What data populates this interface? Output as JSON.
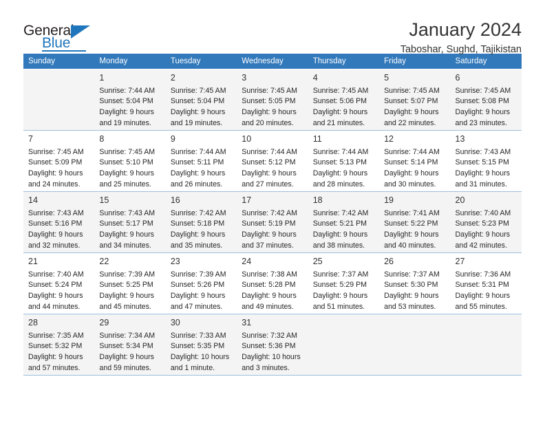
{
  "brand": {
    "word_one": "General",
    "word_two": "Blue",
    "logo_icon": "triangle-flag-icon"
  },
  "header": {
    "month_title": "January 2024",
    "location": "Taboshar, Sughd, Tajikistan"
  },
  "theme": {
    "header_blue": "#3279bb",
    "brand_blue": "#1f76bc",
    "row_alt_bg": "#f4f4f4",
    "grid_line": "#9bbfdd",
    "text": "#262626"
  },
  "calendar": {
    "columns": [
      "Sunday",
      "Monday",
      "Tuesday",
      "Wednesday",
      "Thursday",
      "Friday",
      "Saturday"
    ],
    "weeks": [
      [
        {
          "day": "",
          "info": ""
        },
        {
          "day": "1",
          "info": "Sunrise: 7:44 AM\nSunset: 5:04 PM\nDaylight: 9 hours\nand 19 minutes."
        },
        {
          "day": "2",
          "info": "Sunrise: 7:45 AM\nSunset: 5:04 PM\nDaylight: 9 hours\nand 19 minutes."
        },
        {
          "day": "3",
          "info": "Sunrise: 7:45 AM\nSunset: 5:05 PM\nDaylight: 9 hours\nand 20 minutes."
        },
        {
          "day": "4",
          "info": "Sunrise: 7:45 AM\nSunset: 5:06 PM\nDaylight: 9 hours\nand 21 minutes."
        },
        {
          "day": "5",
          "info": "Sunrise: 7:45 AM\nSunset: 5:07 PM\nDaylight: 9 hours\nand 22 minutes."
        },
        {
          "day": "6",
          "info": "Sunrise: 7:45 AM\nSunset: 5:08 PM\nDaylight: 9 hours\nand 23 minutes."
        }
      ],
      [
        {
          "day": "7",
          "info": "Sunrise: 7:45 AM\nSunset: 5:09 PM\nDaylight: 9 hours\nand 24 minutes."
        },
        {
          "day": "8",
          "info": "Sunrise: 7:45 AM\nSunset: 5:10 PM\nDaylight: 9 hours\nand 25 minutes."
        },
        {
          "day": "9",
          "info": "Sunrise: 7:44 AM\nSunset: 5:11 PM\nDaylight: 9 hours\nand 26 minutes."
        },
        {
          "day": "10",
          "info": "Sunrise: 7:44 AM\nSunset: 5:12 PM\nDaylight: 9 hours\nand 27 minutes."
        },
        {
          "day": "11",
          "info": "Sunrise: 7:44 AM\nSunset: 5:13 PM\nDaylight: 9 hours\nand 28 minutes."
        },
        {
          "day": "12",
          "info": "Sunrise: 7:44 AM\nSunset: 5:14 PM\nDaylight: 9 hours\nand 30 minutes."
        },
        {
          "day": "13",
          "info": "Sunrise: 7:43 AM\nSunset: 5:15 PM\nDaylight: 9 hours\nand 31 minutes."
        }
      ],
      [
        {
          "day": "14",
          "info": "Sunrise: 7:43 AM\nSunset: 5:16 PM\nDaylight: 9 hours\nand 32 minutes."
        },
        {
          "day": "15",
          "info": "Sunrise: 7:43 AM\nSunset: 5:17 PM\nDaylight: 9 hours\nand 34 minutes."
        },
        {
          "day": "16",
          "info": "Sunrise: 7:42 AM\nSunset: 5:18 PM\nDaylight: 9 hours\nand 35 minutes."
        },
        {
          "day": "17",
          "info": "Sunrise: 7:42 AM\nSunset: 5:19 PM\nDaylight: 9 hours\nand 37 minutes."
        },
        {
          "day": "18",
          "info": "Sunrise: 7:42 AM\nSunset: 5:21 PM\nDaylight: 9 hours\nand 38 minutes."
        },
        {
          "day": "19",
          "info": "Sunrise: 7:41 AM\nSunset: 5:22 PM\nDaylight: 9 hours\nand 40 minutes."
        },
        {
          "day": "20",
          "info": "Sunrise: 7:40 AM\nSunset: 5:23 PM\nDaylight: 9 hours\nand 42 minutes."
        }
      ],
      [
        {
          "day": "21",
          "info": "Sunrise: 7:40 AM\nSunset: 5:24 PM\nDaylight: 9 hours\nand 44 minutes."
        },
        {
          "day": "22",
          "info": "Sunrise: 7:39 AM\nSunset: 5:25 PM\nDaylight: 9 hours\nand 45 minutes."
        },
        {
          "day": "23",
          "info": "Sunrise: 7:39 AM\nSunset: 5:26 PM\nDaylight: 9 hours\nand 47 minutes."
        },
        {
          "day": "24",
          "info": "Sunrise: 7:38 AM\nSunset: 5:28 PM\nDaylight: 9 hours\nand 49 minutes."
        },
        {
          "day": "25",
          "info": "Sunrise: 7:37 AM\nSunset: 5:29 PM\nDaylight: 9 hours\nand 51 minutes."
        },
        {
          "day": "26",
          "info": "Sunrise: 7:37 AM\nSunset: 5:30 PM\nDaylight: 9 hours\nand 53 minutes."
        },
        {
          "day": "27",
          "info": "Sunrise: 7:36 AM\nSunset: 5:31 PM\nDaylight: 9 hours\nand 55 minutes."
        }
      ],
      [
        {
          "day": "28",
          "info": "Sunrise: 7:35 AM\nSunset: 5:32 PM\nDaylight: 9 hours\nand 57 minutes."
        },
        {
          "day": "29",
          "info": "Sunrise: 7:34 AM\nSunset: 5:34 PM\nDaylight: 9 hours\nand 59 minutes."
        },
        {
          "day": "30",
          "info": "Sunrise: 7:33 AM\nSunset: 5:35 PM\nDaylight: 10 hours\nand 1 minute."
        },
        {
          "day": "31",
          "info": "Sunrise: 7:32 AM\nSunset: 5:36 PM\nDaylight: 10 hours\nand 3 minutes."
        },
        {
          "day": "",
          "info": ""
        },
        {
          "day": "",
          "info": ""
        },
        {
          "day": "",
          "info": ""
        }
      ]
    ]
  }
}
